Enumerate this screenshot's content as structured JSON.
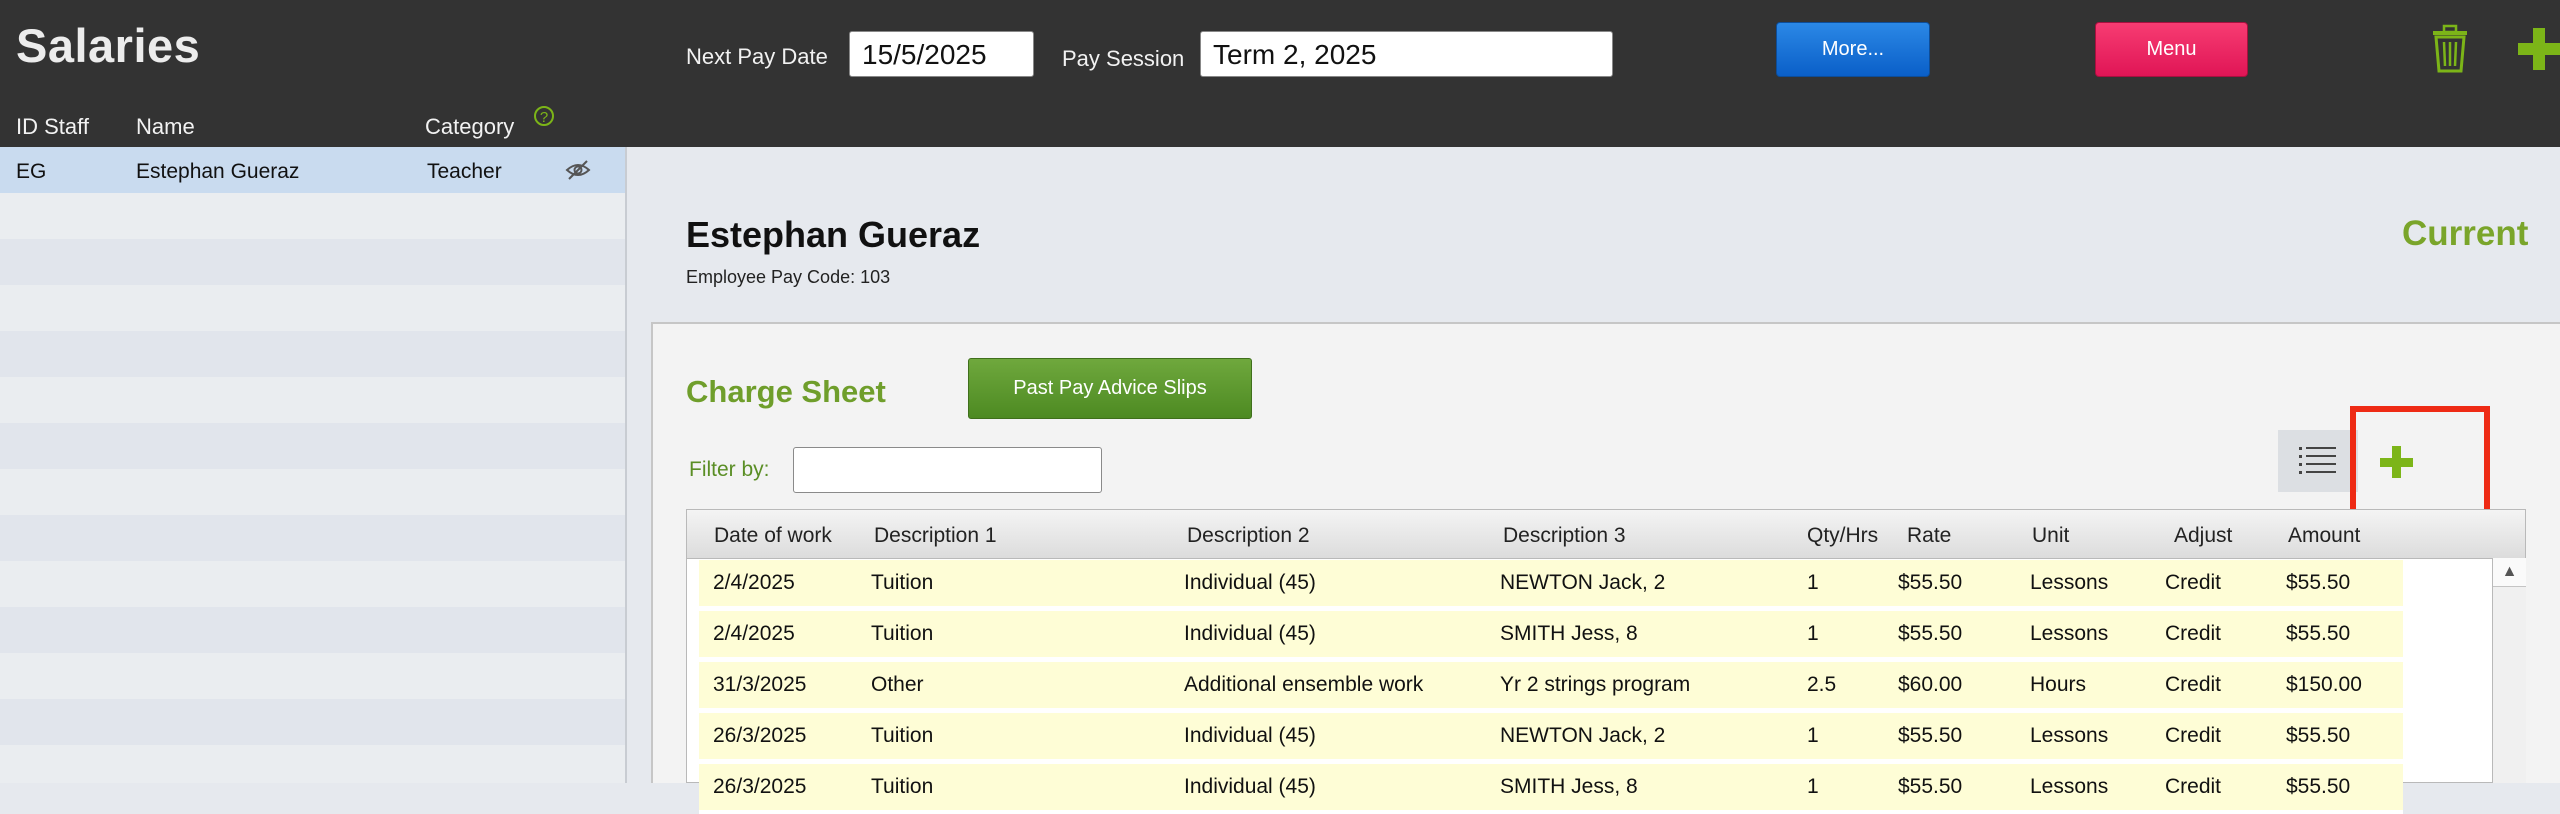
{
  "app": {
    "title": "Salaries"
  },
  "header": {
    "next_pay_date_label": "Next Pay Date",
    "next_pay_date_value": "15/5/2025",
    "pay_session_label": "Pay Session",
    "pay_session_value": "Term 2, 2025",
    "more_label": "More...",
    "menu_label": "Menu"
  },
  "staff_list": {
    "columns": {
      "id": "ID Staff",
      "name": "Name",
      "category": "Category"
    },
    "rows": [
      {
        "id": "EG",
        "name": "Estephan Gueraz",
        "category": "Teacher"
      }
    ]
  },
  "employee": {
    "name": "Estephan Gueraz",
    "pay_code": "Employee Pay Code: 103",
    "status": "Current"
  },
  "charge_sheet": {
    "title": "Charge Sheet",
    "past_slips_label": "Past Pay Advice Slips",
    "filter_label": "Filter by:",
    "filter_value": "",
    "columns": {
      "date": "Date of work",
      "desc1": "Description 1",
      "desc2": "Description 2",
      "desc3": "Description 3",
      "qty": "Qty/Hrs",
      "rate": "Rate",
      "unit": "Unit",
      "adjust": "Adjust",
      "amount": "Amount"
    },
    "rows": [
      {
        "date": "2/4/2025",
        "desc1": "Tuition",
        "desc2": "Individual (45)",
        "desc3": "NEWTON Jack, 2",
        "qty": "1",
        "rate": "$55.50",
        "unit": "Lessons",
        "adjust": "Credit",
        "amount": "$55.50"
      },
      {
        "date": "2/4/2025",
        "desc1": "Tuition",
        "desc2": "Individual (45)",
        "desc3": "SMITH Jess, 8",
        "qty": "1",
        "rate": "$55.50",
        "unit": "Lessons",
        "adjust": "Credit",
        "amount": "$55.50"
      },
      {
        "date": "31/3/2025",
        "desc1": "Other",
        "desc2": "Additional ensemble work",
        "desc3": "Yr 2 strings program",
        "qty": "2.5",
        "rate": "$60.00",
        "unit": "Hours",
        "adjust": "Credit",
        "amount": "$150.00"
      },
      {
        "date": "26/3/2025",
        "desc1": "Tuition",
        "desc2": "Individual (45)",
        "desc3": "NEWTON Jack, 2",
        "qty": "1",
        "rate": "$55.50",
        "unit": "Lessons",
        "adjust": "Credit",
        "amount": "$55.50"
      },
      {
        "date": "26/3/2025",
        "desc1": "Tuition",
        "desc2": "Individual (45)",
        "desc3": "SMITH Jess, 8",
        "qty": "1",
        "rate": "$55.50",
        "unit": "Lessons",
        "adjust": "Credit",
        "amount": "$55.50"
      }
    ]
  },
  "icons": {
    "trash": "trash-icon",
    "add": "plus-icon",
    "list": "list-icon",
    "help": "question-icon",
    "hidden": "eye-slash-icon"
  },
  "colors": {
    "topbar": "#333333",
    "accent_green": "#7cb518",
    "more_blue": "#0a5fc8",
    "menu_pink": "#e01556",
    "highlight_red": "#ee2a14",
    "row_yellow": "#fefdd6"
  }
}
